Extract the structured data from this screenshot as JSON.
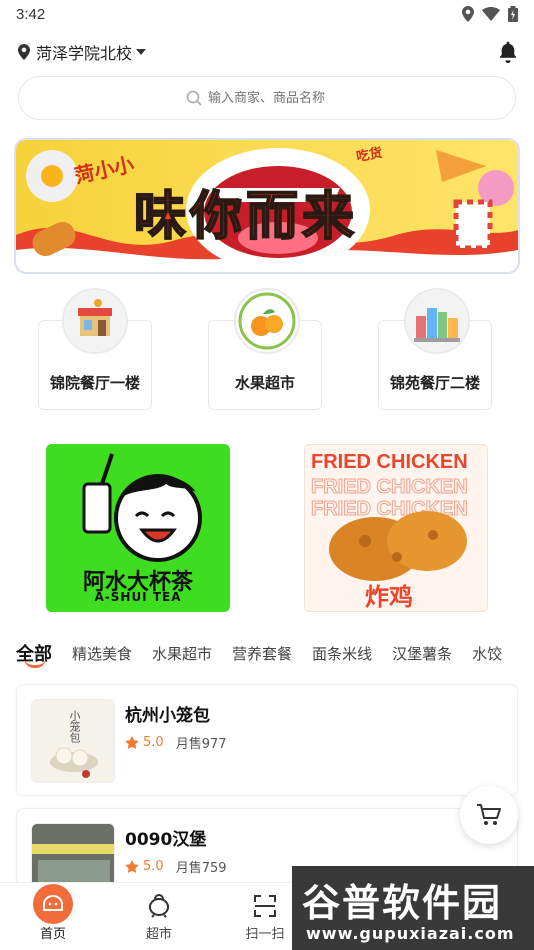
{
  "status_bar": {
    "time": "3:42"
  },
  "header": {
    "location": "菏泽学院北校"
  },
  "search": {
    "placeholder": "输入商家、商品名称"
  },
  "banner": {
    "brand_tag": "菏小小",
    "headline": "味你而来",
    "corner_tag": "吃货"
  },
  "categories": [
    {
      "label": "锦院餐厅一楼",
      "icon": "store-icon"
    },
    {
      "label": "水果超市",
      "icon": "orange-icon"
    },
    {
      "label": "锦苑餐厅二楼",
      "icon": "city-icon"
    }
  ],
  "promos": [
    {
      "title": "阿水大杯茶",
      "subtitle": "A-SHUI TEA",
      "bg": "#3fdd1f"
    },
    {
      "title": "FRIED CHICKEN",
      "caption": "炸鸡",
      "bg": "#fff4ee"
    }
  ],
  "tabs": [
    "全部",
    "精选美食",
    "水果超市",
    "营养套餐",
    "面条米线",
    "汉堡薯条",
    "水饺"
  ],
  "shops": [
    {
      "name": "杭州小笼包",
      "rating": "5.0",
      "sales": "月售977",
      "thumb_text": "小笼包"
    },
    {
      "name": "0090汉堡",
      "rating": "5.0",
      "sales": "月售759"
    }
  ],
  "bottom_nav": [
    {
      "label": "首页",
      "icon": "home-icon"
    },
    {
      "label": "超市",
      "icon": "shop-icon"
    },
    {
      "label": "扫一扫",
      "icon": "scan-icon"
    }
  ],
  "watermark": {
    "title": "谷普软件园",
    "url": "www.gupuxiazai.com"
  },
  "colors": {
    "accent": "#f26b3a",
    "rating": "#f07a2f"
  }
}
